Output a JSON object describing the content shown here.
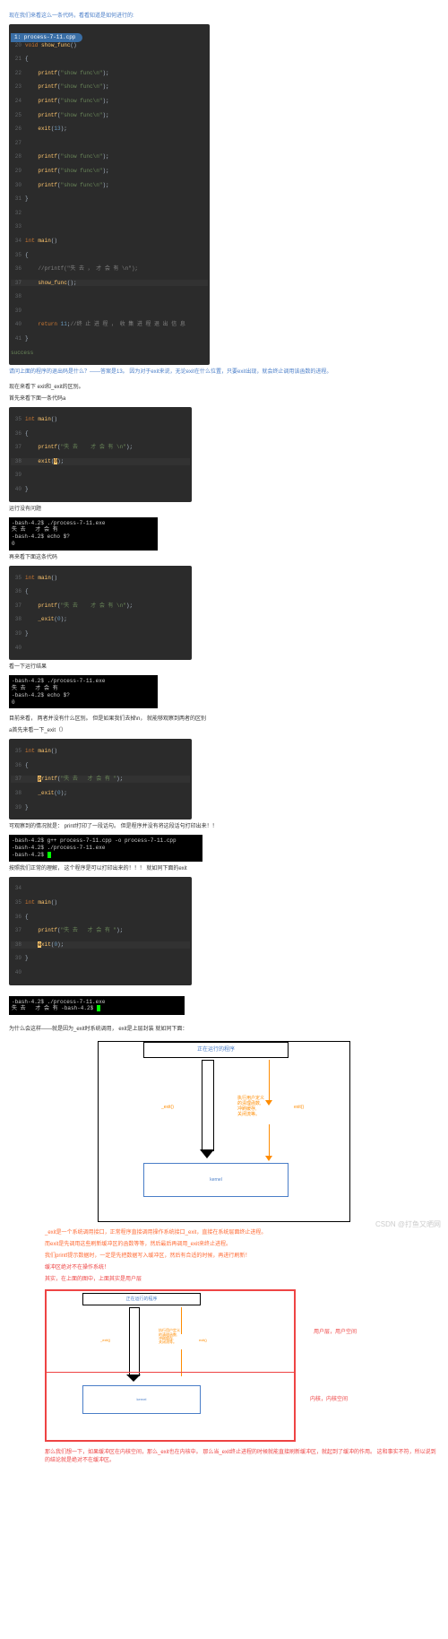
{
  "intro": "现在我们来看这么一条代码，看看知道是如何进行的:",
  "code1": {
    "tab": "1: process-7-11.cpp",
    "lines": [
      {
        "n": "20",
        "t": "void show_func()"
      },
      {
        "n": "21",
        "t": "{"
      },
      {
        "n": "22",
        "t": "    printf(\"show func\\n\");"
      },
      {
        "n": "23",
        "t": "    printf(\"show func\\n\");"
      },
      {
        "n": "24",
        "t": "    printf(\"show func\\n\");"
      },
      {
        "n": "25",
        "t": "    printf(\"show func\\n\");"
      },
      {
        "n": "26",
        "t": "    exit(13);"
      },
      {
        "n": "27",
        "t": ""
      },
      {
        "n": "28",
        "t": "    printf(\"show func\\n\");"
      },
      {
        "n": "29",
        "t": "    printf(\"show func\\n\");"
      },
      {
        "n": "30",
        "t": "    printf(\"show func\\n\");"
      },
      {
        "n": "31",
        "t": "}"
      },
      {
        "n": "32",
        "t": ""
      },
      {
        "n": "33",
        "t": ""
      },
      {
        "n": "34",
        "t": "int main()"
      },
      {
        "n": "35",
        "t": "{"
      },
      {
        "n": "36",
        "t": "    //printf(\"失 去 ， 才 会 有 \\n\");"
      },
      {
        "n": "37",
        "t": "    show_func();",
        "hl": true
      },
      {
        "n": "38",
        "t": ""
      },
      {
        "n": "39",
        "t": ""
      },
      {
        "n": "40",
        "t": "    return 11;//终 止 进 程 ， 收 集 进 程 退 出 信 息"
      },
      {
        "n": "41",
        "t": "}"
      }
    ],
    "success": "success"
  },
  "q1": "请问上面的程序的退出码是什么？——答案是13。 因为对于exit来说，无论exit在什么位置，只要exit出现，就会终止调用该函数的进程。",
  "p1": "现在来看下 exit和_exit的区别。",
  "p2": "首先来看下面一条代码a",
  "code2": {
    "lines": [
      {
        "n": "35",
        "t": "int main()"
      },
      {
        "n": "36",
        "t": "{"
      },
      {
        "n": "37",
        "t": "    printf(\"失 去    才 会 有 \\n\");"
      },
      {
        "n": "38",
        "t": "    exit(0);",
        "hl": true
      },
      {
        "n": "39",
        "t": ""
      },
      {
        "n": "40",
        "t": "}"
      }
    ]
  },
  "p3": "运行没有问题",
  "term1": "-bash-4.2$ ./process-7-11.exe\n失 去   才 会 有\n-bash-4.2$ echo $?\n0",
  "p4": "再来看下面这条代码",
  "code3": {
    "lines": [
      {
        "n": "35",
        "t": "int main()"
      },
      {
        "n": "36",
        "t": "{"
      },
      {
        "n": "37",
        "t": "    printf(\"失 去    才 会 有 \\n\");"
      },
      {
        "n": "38",
        "t": "    _exit(0);"
      },
      {
        "n": "39",
        "t": "}"
      },
      {
        "n": "40",
        "t": ""
      }
    ]
  },
  "p5": "看一下运行结果",
  "term2": "-bash-4.2$ ./process-7-11.exe\n失 去   才 会 有\n-bash-4.2$ echo $?\n0",
  "p6": "目前来看， 两者并没有什么区别。 但是如果我们去掉\\n， 就能够观察到两者的区别",
  "p7": "a首先来看一下_exit（）",
  "code4": {
    "lines": [
      {
        "n": "35",
        "t": "int main()"
      },
      {
        "n": "36",
        "t": "{"
      },
      {
        "n": "37",
        "t": "    printf(\"失 去   才 会 有 \");",
        "hl": true
      },
      {
        "n": "38",
        "t": "    _exit(0);"
      },
      {
        "n": "39",
        "t": "}"
      }
    ]
  },
  "p8": "可观察到的情况就是： printf打印了一段话句。 但是程序并没有将这段话句打印出来！！",
  "term3": "-bash-4.2$ ./process-7-11.exe\n-bash-4.2$",
  "p9": "按照我们正常的理解， 这个程序是可以打印出来的！！！ 就如同下面的exit",
  "code5": {
    "lines": [
      {
        "n": "34",
        "t": ""
      },
      {
        "n": "35",
        "t": "int main()"
      },
      {
        "n": "36",
        "t": "{"
      },
      {
        "n": "37",
        "t": "    printf(\"失 去   才 会 有 \");"
      },
      {
        "n": "38",
        "t": "    exit(0);",
        "hl": true
      },
      {
        "n": "39",
        "t": "}"
      },
      {
        "n": "40",
        "t": ""
      }
    ]
  },
  "term4": "-bash-4.2$ ./process-7-11.exe\n失 去   才 会 有 -bash-4.2$",
  "p10": "为什么会这样——就是因为_exit时系统调用， exit是上层封装 就如同下面：",
  "diag": {
    "top": "正在运行的程序",
    "bottom": "kernel",
    "left": "_exit()",
    "right": "exit()",
    "mid": "执行用户定义\n的清理函数,\n冲刷缓存,\n关闭流等。"
  },
  "bullets": {
    "b1": "_exit是一个系统调用接口，正常程序直接调用操作系统接口_exit，直接在系统层面终止进程。",
    "b2": "而exit是先调用这些刷新缓冲区的函数等等，然后最后再调用_exit来终止进程。",
    "b3": "我们printf提示数据时，一定是先把数据写入缓冲区，然后有合适的时候，再进行刷新！",
    "b4": "缓冲区绝对不在操作系统！",
    "b5": "其实，在上面的图中，上面其实是用户层"
  },
  "labels": {
    "user": "用户层，用户空间",
    "kernel": "内核，内核空间",
    "rtop": "正在运行的程序",
    "rmid": "执行用户定义\n的清理函数,\n冲刷缓存,\n关闭流等。",
    "rbot": "kernel"
  },
  "final": "那么我们想一下，如果缓冲区在内核空间，那么_exit也在内核中。 那么当_exit终止进程的时候就能直接刷新缓冲区，就起到了缓冲的作用。 这和事实不符，所以说到的结论就是绝对不在缓冲区。",
  "wm": "CSDN @打鱼又晒网"
}
